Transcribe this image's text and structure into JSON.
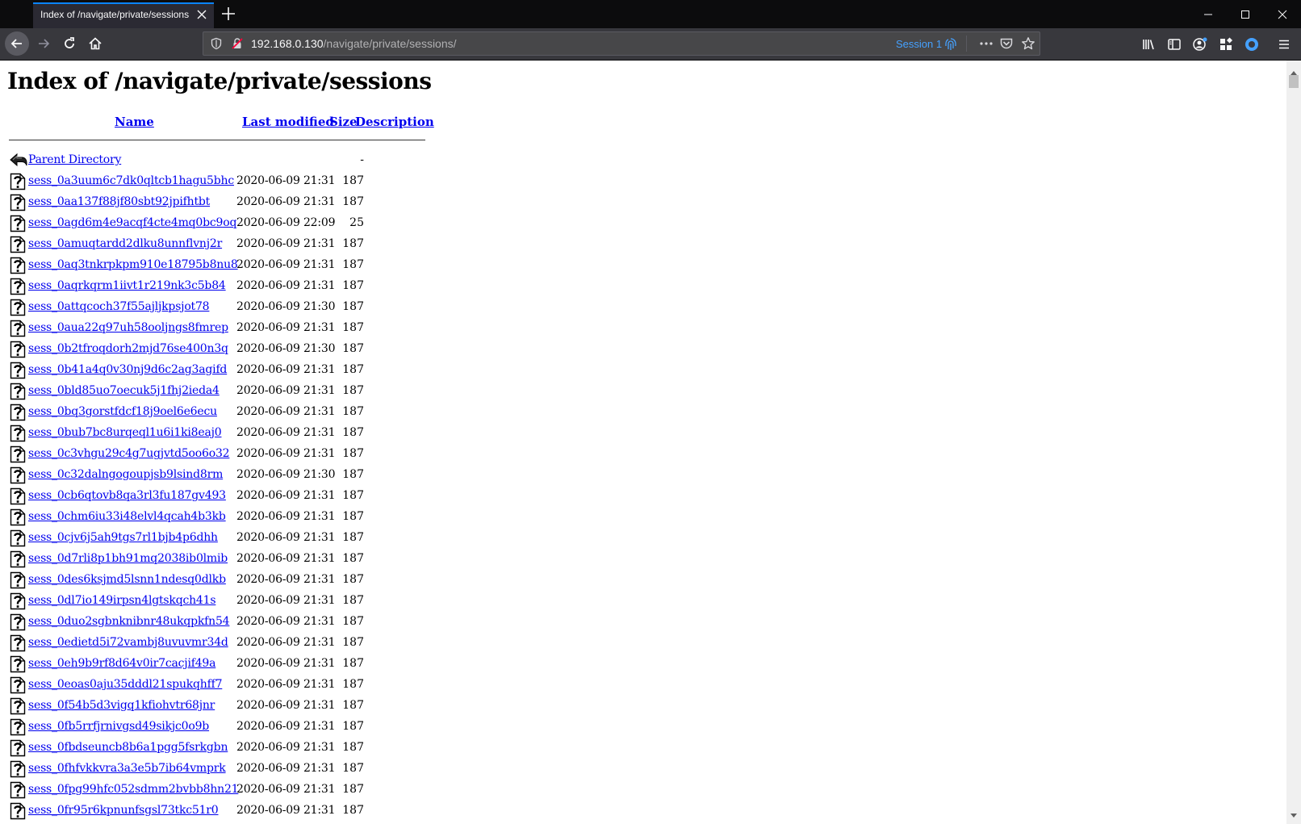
{
  "browser": {
    "tab_title": "Index of /navigate/private/sessions",
    "url_host": "192.168.0.130",
    "url_path": "/navigate/private/sessions/",
    "session_label": "Session 1",
    "accent_color": "#0a84ff"
  },
  "page": {
    "title": "Index of /navigate/private/sessions",
    "columns": {
      "name": "Name",
      "last_modified": "Last modified",
      "size": "Size",
      "description": "Description"
    },
    "parent": {
      "name": "Parent Directory",
      "size": "-",
      "icon": "back-arrow-icon"
    },
    "rows": [
      {
        "name": "sess_0a3uum6c7dk0qltcb1hagu5bhc",
        "modified": "2020-06-09 21:31",
        "size": "187"
      },
      {
        "name": "sess_0aa137f88jf80sbt92jpifhtbt",
        "modified": "2020-06-09 21:31",
        "size": "187"
      },
      {
        "name": "sess_0agd6m4e9acqf4cte4mq0bc9oq",
        "modified": "2020-06-09 22:09",
        "size": "25"
      },
      {
        "name": "sess_0amuqtardd2dlku8unnflvnj2r",
        "modified": "2020-06-09 21:31",
        "size": "187"
      },
      {
        "name": "sess_0aq3tnkrpkpm910e18795b8nu8",
        "modified": "2020-06-09 21:31",
        "size": "187"
      },
      {
        "name": "sess_0aqrkqrm1iivt1r219nk3c5b84",
        "modified": "2020-06-09 21:31",
        "size": "187"
      },
      {
        "name": "sess_0attqcoch37f55ajljkpsjot78",
        "modified": "2020-06-09 21:30",
        "size": "187"
      },
      {
        "name": "sess_0aua22q97uh58ooljngs8fmrep",
        "modified": "2020-06-09 21:31",
        "size": "187"
      },
      {
        "name": "sess_0b2tfroqdorh2mjd76se400n3q",
        "modified": "2020-06-09 21:30",
        "size": "187"
      },
      {
        "name": "sess_0b41a4q0v30nj9d6c2ag3agifd",
        "modified": "2020-06-09 21:31",
        "size": "187"
      },
      {
        "name": "sess_0bld85uo7oecuk5j1fhj2ieda4",
        "modified": "2020-06-09 21:31",
        "size": "187"
      },
      {
        "name": "sess_0bq3gorstfdcf18j9oel6e6ecu",
        "modified": "2020-06-09 21:31",
        "size": "187"
      },
      {
        "name": "sess_0bub7bc8urqeql1u6i1ki8eaj0",
        "modified": "2020-06-09 21:31",
        "size": "187"
      },
      {
        "name": "sess_0c3vhgu29c4g7ugjvtd5oo6o32",
        "modified": "2020-06-09 21:31",
        "size": "187"
      },
      {
        "name": "sess_0c32dalngogoupjsb9lsind8rm",
        "modified": "2020-06-09 21:30",
        "size": "187"
      },
      {
        "name": "sess_0cb6qtovb8qa3rl3fu187gv493",
        "modified": "2020-06-09 21:31",
        "size": "187"
      },
      {
        "name": "sess_0chm6iu33i48elvl4qcah4b3kb",
        "modified": "2020-06-09 21:31",
        "size": "187"
      },
      {
        "name": "sess_0cjv6j5ah9tgs7rl1bjb4p6dhh",
        "modified": "2020-06-09 21:31",
        "size": "187"
      },
      {
        "name": "sess_0d7rli8p1bh91mq2038ib0lmib",
        "modified": "2020-06-09 21:31",
        "size": "187"
      },
      {
        "name": "sess_0des6ksjmd5lsnn1ndesq0dlkb",
        "modified": "2020-06-09 21:31",
        "size": "187"
      },
      {
        "name": "sess_0dl7io149irpsn4lgtskqch41s",
        "modified": "2020-06-09 21:31",
        "size": "187"
      },
      {
        "name": "sess_0duo2sgbnknibnr48ukqpkfn54",
        "modified": "2020-06-09 21:31",
        "size": "187"
      },
      {
        "name": "sess_0edietd5i72vambj8uvuvmr34d",
        "modified": "2020-06-09 21:31",
        "size": "187"
      },
      {
        "name": "sess_0eh9b9rf8d64v0ir7cacjif49a",
        "modified": "2020-06-09 21:31",
        "size": "187"
      },
      {
        "name": "sess_0eoas0aju35dddl21spukqhff7",
        "modified": "2020-06-09 21:31",
        "size": "187"
      },
      {
        "name": "sess_0f54b5d3vigq1kfiohvtr68jnr",
        "modified": "2020-06-09 21:31",
        "size": "187"
      },
      {
        "name": "sess_0fb5rrfjrnivgsd49sikjc0o9b",
        "modified": "2020-06-09 21:31",
        "size": "187"
      },
      {
        "name": "sess_0fbdseuncb8b6a1pgg5fsrkgbn",
        "modified": "2020-06-09 21:31",
        "size": "187"
      },
      {
        "name": "sess_0fhfvkkvra3a3e5b7ib64vmprk",
        "modified": "2020-06-09 21:31",
        "size": "187"
      },
      {
        "name": "sess_0fpg99hfc052sdmm2bvbb8hn21",
        "modified": "2020-06-09 21:31",
        "size": "187"
      },
      {
        "name": "sess_0fr95r6kpnunfsgsl73tkc51r0",
        "modified": "2020-06-09 21:31",
        "size": "187"
      }
    ]
  }
}
